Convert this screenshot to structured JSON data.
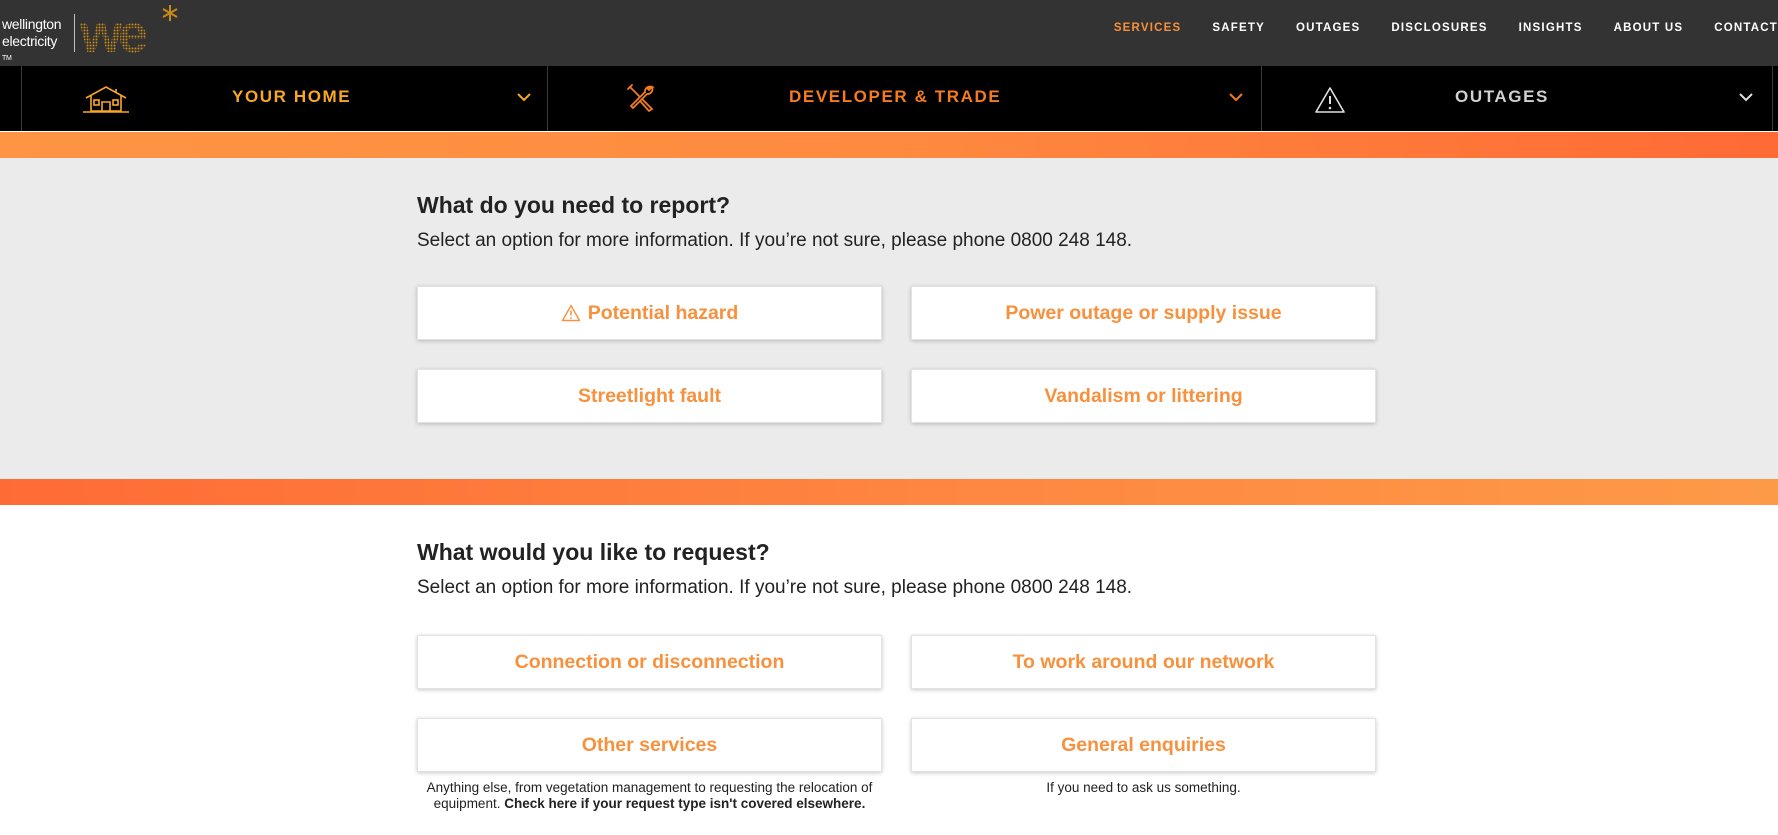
{
  "logo": {
    "line1": "wellington",
    "line2": "electricity",
    "trademark": "TM",
    "mark_text": "we"
  },
  "topnav": {
    "items": [
      "SERVICES",
      "SAFETY",
      "OUTAGES",
      "DISCLOSURES",
      "INSIGHTS",
      "ABOUT US",
      "CONTACT"
    ],
    "active_index": 0
  },
  "mega_nav": {
    "items": [
      {
        "label": "YOUR HOME",
        "icon": "house-icon",
        "color": "#f9a825"
      },
      {
        "label": "DEVELOPER & TRADE",
        "icon": "tools-icon",
        "color": "#f47b20"
      },
      {
        "label": "OUTAGES",
        "icon": "warning-triangle-icon",
        "color": "#d0d0d0"
      }
    ]
  },
  "report": {
    "heading": "What do you need to report?",
    "intro": "Select an option for more information. If you’re not sure, please phone 0800 248 148.",
    "options": [
      "Potential hazard",
      "Power outage or supply issue",
      "Streetlight fault",
      "Vandalism or littering"
    ]
  },
  "request": {
    "heading": "What would you like to request?",
    "intro": "Select an option for more information. If you’re not sure, please phone 0800 248 148.",
    "options": [
      "Connection or disconnection",
      "To work around our network",
      "Other services",
      "General enquiries"
    ],
    "other_services_note": "Anything else, from vegetation management to requesting the relocation of equipment.",
    "other_services_link": "Check here if your request type isn't covered elsewhere.",
    "general_enquiries_note": "If you need to ask us something."
  },
  "colors": {
    "accent": "#f7913d",
    "topbar": "#333333",
    "mega_nav": "#000000",
    "section_grey": "#ebebeb"
  }
}
